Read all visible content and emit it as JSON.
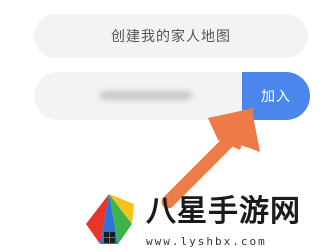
{
  "create_button": {
    "label": "创建我的家人地图"
  },
  "join_row": {
    "code_value": "",
    "join_label": "加入"
  },
  "watermark": {
    "title": "八星手游网",
    "url": "www.lyshbx.com",
    "logo_colors": [
      "#e8342b",
      "#2f73d6",
      "#3cb449",
      "#f7c21b"
    ]
  },
  "colors": {
    "pill_background": "#f3f3f3",
    "join_button": "#4a86ec",
    "arrow": "#ee7b47"
  }
}
